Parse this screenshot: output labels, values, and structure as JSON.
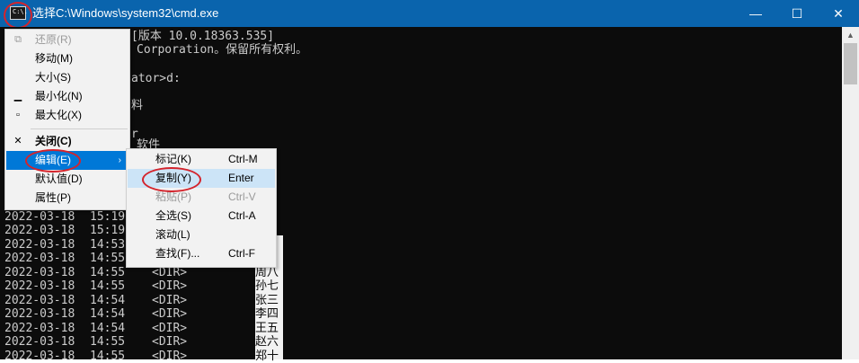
{
  "window": {
    "title": "选择C:\\Windows\\system32\\cmd.exe",
    "icon_text": "C:\\.",
    "controls": {
      "minimize": "—",
      "maximize": "☐",
      "close": "✕"
    }
  },
  "console": {
    "fragments": [
      "[版本 10.0.18363.535]",
      "Corporation。保留所有权利。",
      "ator>d:",
      "料",
      "r",
      "软件"
    ],
    "rows": [
      {
        "date": "2022-03-18",
        "time": "15:19",
        "kind": "",
        "name": ""
      },
      {
        "date": "2022-03-18",
        "time": "15:19",
        "kind": "",
        "name": ""
      },
      {
        "date": "2022-03-18",
        "time": "14:53",
        "kind": "",
        "name": "比"
      },
      {
        "date": "2022-03-18",
        "time": "14:55",
        "kind": "<DIR>",
        "name": "五"
      },
      {
        "date": "2022-03-18",
        "time": "14:55",
        "kind": "<DIR>",
        "name": "周八"
      },
      {
        "date": "2022-03-18",
        "time": "14:55",
        "kind": "<DIR>",
        "name": "孙七"
      },
      {
        "date": "2022-03-18",
        "time": "14:54",
        "kind": "<DIR>",
        "name": "张三"
      },
      {
        "date": "2022-03-18",
        "time": "14:54",
        "kind": "<DIR>",
        "name": "李四"
      },
      {
        "date": "2022-03-18",
        "time": "14:54",
        "kind": "<DIR>",
        "name": "王五"
      },
      {
        "date": "2022-03-18",
        "time": "14:55",
        "kind": "<DIR>",
        "name": "赵六"
      },
      {
        "date": "2022-03-18",
        "time": "14:55",
        "kind": "<DIR>",
        "name": "郑十"
      }
    ]
  },
  "system_menu": {
    "items": [
      {
        "label": "还原(R)",
        "icon": "restore-icon",
        "glyph": "⧉",
        "disabled": true
      },
      {
        "label": "移动(M)",
        "icon": "",
        "glyph": "",
        "disabled": false
      },
      {
        "label": "大小(S)",
        "icon": "",
        "glyph": "",
        "disabled": false
      },
      {
        "label": "最小化(N)",
        "icon": "minimize-icon",
        "glyph": "▁",
        "disabled": false
      },
      {
        "label": "最大化(X)",
        "icon": "maximize-icon",
        "glyph": "▫",
        "disabled": false
      },
      {
        "label": "关闭(C)",
        "icon": "close-icon",
        "glyph": "✕",
        "disabled": false
      },
      {
        "label": "编辑(E)",
        "arrow": "›",
        "highlighted": true
      },
      {
        "label": "默认值(D)"
      },
      {
        "label": "属性(P)"
      }
    ]
  },
  "edit_submenu": {
    "items": [
      {
        "label": "标记(K)",
        "shortcut": "Ctrl-M",
        "disabled": false
      },
      {
        "label": "复制(Y)",
        "shortcut": "Enter",
        "disabled": false,
        "highlighted": true
      },
      {
        "label": "粘贴(P)",
        "shortcut": "Ctrl-V",
        "disabled": true
      },
      {
        "label": "全选(S)",
        "shortcut": "Ctrl-A",
        "disabled": false
      },
      {
        "label": "滚动(L)",
        "shortcut": "",
        "disabled": false
      },
      {
        "label": "查找(F)...",
        "shortcut": "Ctrl-F",
        "disabled": false
      }
    ]
  },
  "colors": {
    "titlebar": "#0a64ad",
    "console_bg": "#0c0c0c",
    "console_text": "#cccccc",
    "menu_highlight": "#0078d7",
    "annotation_ring": "#d4242c"
  }
}
